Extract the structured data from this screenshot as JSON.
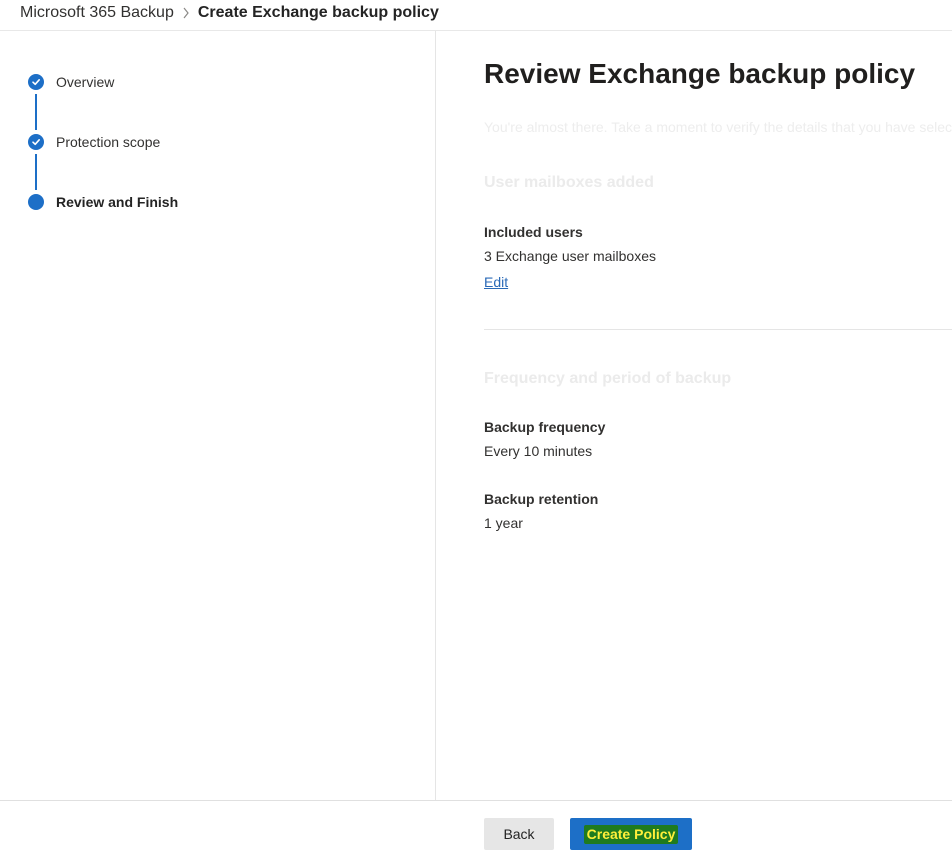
{
  "breadcrumb": {
    "root": "Microsoft 365 Backup",
    "current": "Create Exchange backup policy"
  },
  "steps": [
    {
      "label": "Overview",
      "state": "completed"
    },
    {
      "label": "Protection scope",
      "state": "completed"
    },
    {
      "label": "Review and Finish",
      "state": "current"
    }
  ],
  "main": {
    "title": "Review Exchange backup policy",
    "intro": "You're almost there. Take a moment to verify the details that you have selected",
    "mailboxes_section": {
      "heading": "User mailboxes added",
      "included_users_label": "Included users",
      "included_users_value": "3 Exchange user mailboxes",
      "edit_label": "Edit"
    },
    "frequency_section": {
      "heading": "Frequency and period of backup",
      "frequency_label": "Backup frequency",
      "frequency_value": "Every 10 minutes",
      "retention_label": "Backup retention",
      "retention_value": "1 year"
    }
  },
  "footer": {
    "back_label": "Back",
    "create_label": "Create Policy"
  },
  "colors": {
    "accent": "#1d6fc7",
    "highlight_bg": "#1f7b1f",
    "highlight_text": "#ffef3a"
  }
}
